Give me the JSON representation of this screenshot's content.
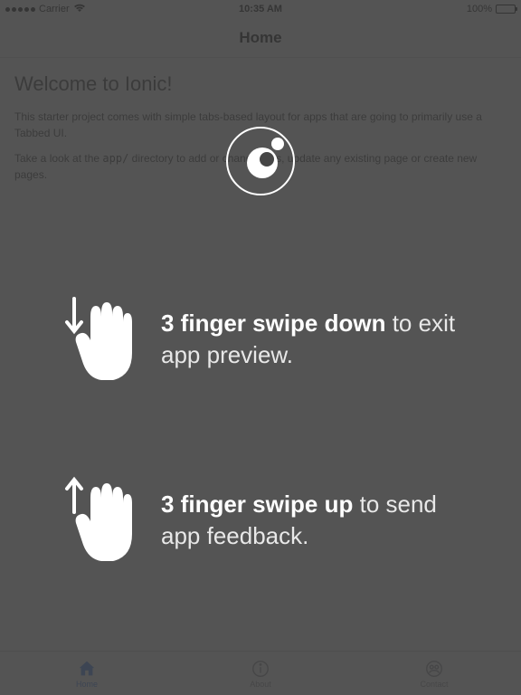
{
  "status_bar": {
    "carrier": "Carrier",
    "time": "10:35 AM",
    "battery_percent": "100%"
  },
  "header": {
    "title": "Home"
  },
  "content": {
    "heading": "Welcome to Ionic!",
    "p1": "This starter project comes with simple tabs-based layout for apps that are going to primarily use a Tabbed UI.",
    "p2_before": "Take a look at the ",
    "p2_code": "app/",
    "p2_after": " directory to add or change tabs, update any existing page or create new pages."
  },
  "tabs": {
    "home": "Home",
    "about": "About",
    "contact": "Contact"
  },
  "overlay": {
    "down_bold": "3 finger swipe down",
    "down_rest": " to exit app preview.",
    "up_bold": "3 finger swipe up",
    "up_rest": " to send app feedback."
  }
}
